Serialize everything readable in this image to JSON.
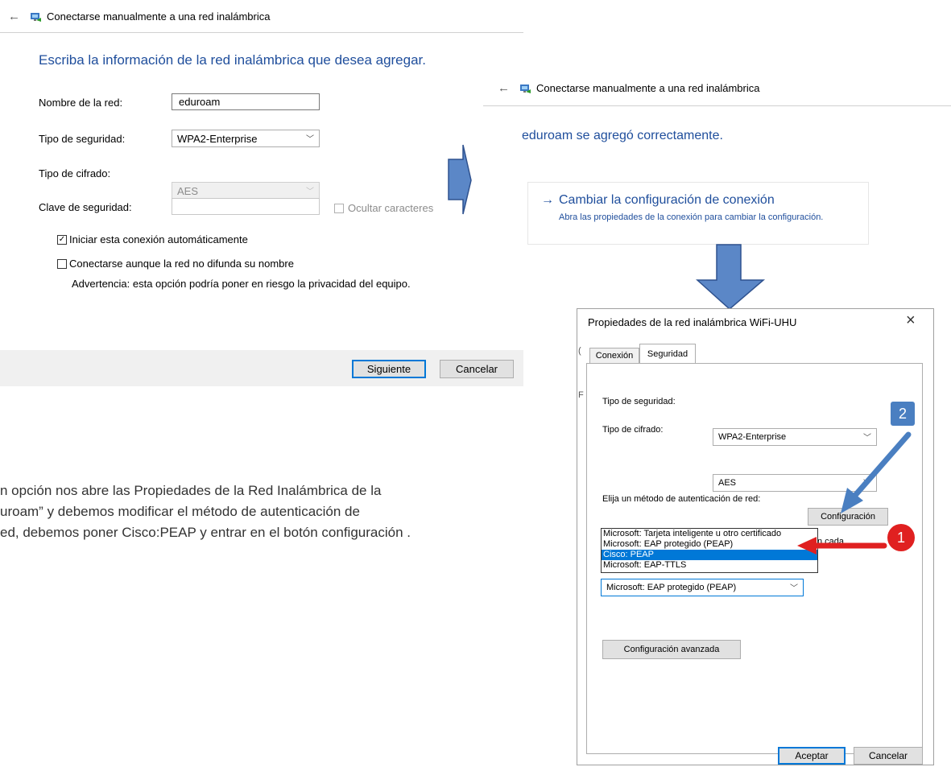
{
  "window1": {
    "title": "Conectarse manualmente a una red inalámbrica",
    "heading": "Escriba la información de la red inalámbrica que desea agregar.",
    "network_name_label": "Nombre de la red:",
    "network_name_value": "eduroam",
    "security_type_label": "Tipo de seguridad:",
    "security_type_value": "WPA2-Enterprise",
    "encryption_label": "Tipo de cifrado:",
    "encryption_value": "AES",
    "key_label": "Clave de seguridad:",
    "key_value": "",
    "hide_chars_label": "Ocultar caracteres",
    "auto_connect_label": "Iniciar esta conexión automáticamente",
    "auto_connect_checked": "✓",
    "connect_hidden_label": "Conectarse aunque la red no difunda su nombre",
    "warning": "Advertencia: esta opción podría poner en riesgo la privacidad del equipo.",
    "next_button": "Siguiente",
    "cancel_button": "Cancelar"
  },
  "window2": {
    "title": "Conectarse manualmente a una red inalámbrica",
    "success": "eduroam se agregó correctamente.",
    "change_link_arrow": "→",
    "change_link": "Cambiar la configuración de conexión",
    "change_desc": "Abra las propiedades de la conexión para cambiar la configuración."
  },
  "instruction": {
    "line1": "n opción nos abre las Propiedades de la Red Inalámbrica de la",
    "line2": "uroam” y debemos modificar el método de autenticación de",
    "line3": "ed, debemos poner Cisco:PEAP y entrar en el botón configuración ."
  },
  "dialog": {
    "title": "Propiedades de la red inalámbrica WiFi-UHU",
    "close": "×",
    "tab_connection": "Conexión",
    "tab_security": "Seguridad",
    "security_type_label": "Tipo de seguridad:",
    "security_type_value": "WPA2-Enterprise",
    "encryption_label": "Tipo de cifrado:",
    "encryption_value": "AES",
    "auth_label": "Elija un método de autenticación de red:",
    "auth_value": "Microsoft: EAP protegido (PEAP)",
    "auth_options": [
      "Microsoft: Tarjeta inteligente u otro certificado",
      "Microsoft: EAP protegido (PEAP)",
      "Cisco: PEAP",
      "Microsoft: EAP-TTLS"
    ],
    "settings_button": "Configuración",
    "cut_text": "n cada",
    "advanced_button": "Configuración avanzada",
    "ok_button": "Aceptar",
    "cancel_button": "Cancelar",
    "edge_letter_c": "(",
    "edge_letter_f": "F"
  },
  "badges": {
    "one": "1",
    "two": "2"
  },
  "colors": {
    "heading": "#1f4e9c",
    "arrow": "#5b87c7",
    "badge1": "#e02020",
    "badge2": "#4a7fc1",
    "highlight": "#0078d7"
  }
}
